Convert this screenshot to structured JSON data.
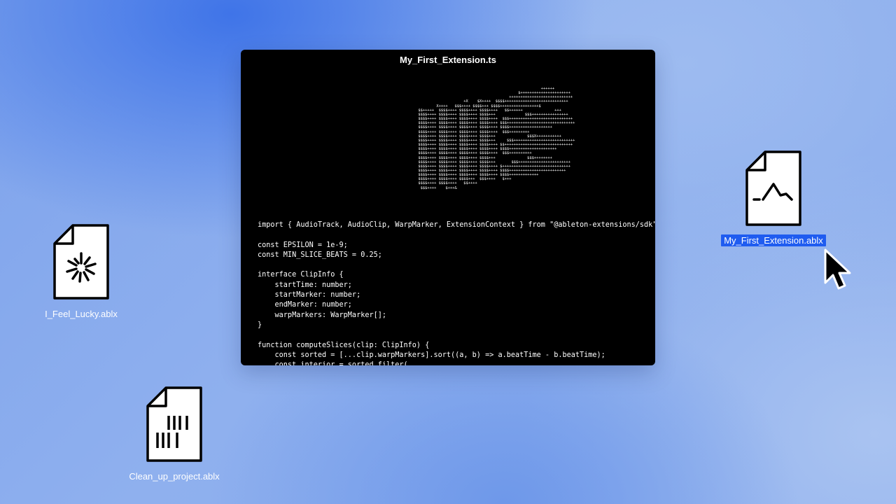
{
  "window": {
    "title": "My_First_Extension.ts",
    "ascii_art": "                                                                            ++++++\n                                                                  $++++++++++++++++++++++\n                                                              ++++++++++++++++++++++++++++\n                                          +X    $X++++  $$$$++++++++++++++++++++++++++++\n                              X++++   $$$++++ $$$$+++ $$$$+++++++++++++++++$\n                      $$+++++  $$$$++++ $$$$++++ $$$$++++   $$++++++              +++\n                      $$$$++++ $$$$++++ $$$$++++ $$$$+++             $$$++++++++++++++++\n                      $$$$++++ $$$$++++ $$$$++++ $$$$++++  $$$++++++++++++++++++++++++++++\n                      $$$$++++ $$$$++++ $$$$++++ $$$$++++ $$$++++++++++++++++++++++++++++++\n                      $$$$++++ $$$$++++ $$$$++++ $$$$++++ $$$$+++++++++++++++++++\n                      $$$$++++ $$$$++++ $$$$++++ $$$$++++  $$$+++++++++\n                      $$$$++++ $$$$++++ $$$$++++ $$$$+++              $$$X+++++++++++\n                      $$$$++++ $$$$++++ $$$$++++ $$$$+++     $$$+++++++++++++++++++++++++++\n                      $$$$++++ $$$$++++ $$$$++++ $$$$++++ $$++++++++++++++++++++++++++++++\n                      $$$$++++ $$$$++++ $$$$++++ $$$$++++ $$$$+++++++++++++++++++++\n                      $$$$++++ $$$$++++ $$$$++++ $$$$++++  $$$++++++++++\n                      $$$$++++ $$$$++++ $$$$++++ $$$$+++              $$$++++++++\n                      $$$$++++ $$$$++++ $$$$++++ $$$$+++       $$$+++++++++++++++++++++++\n                      $$$$++++ $$$$++++ $$$$++++ $$$$++++ $++++++++++++++++++++++++++++++\n                      $$$$++++ $$$$++++ $$$$++++ $$$$++++ $$$$+++++++++++++++++++++++++\n                      $$$$++++ $$$$++++ $$$$++++ $$$$++++ $$$$+++++++++++++\n                      $$$$++++ $$$$++++ $$$$+++  $$$++++   $+++\n                      $$$$++++ $$$$++++   $$++++\n                       $$$++++    $+++&",
    "code": "import { AudioTrack, AudioClip, WarpMarker, ExtensionContext } from \"@ableton-extensions/sdk\";\n\nconst EPSILON = 1e-9;\nconst MIN_SLICE_BEATS = 0.25;\n\ninterface ClipInfo {\n    startTime: number;\n    startMarker: number;\n    endMarker: number;\n    warpMarkers: WarpMarker[];\n}\n\nfunction computeSlices(clip: ClipInfo) {\n    const sorted = [...clip.warpMarkers].sort((a, b) => a.beatTime - b.beatTime);\n    const interior = sorted.filter("
  },
  "desktop": {
    "files": [
      {
        "name": "I_Feel_Lucky.ablx",
        "icon": "sparkle-file-icon",
        "selected": false
      },
      {
        "name": "Clean_up_project.ablx",
        "icon": "barcode-file-icon",
        "selected": false
      },
      {
        "name": "My_First_Extension.ablx",
        "icon": "waveform-file-icon",
        "selected": true
      }
    ]
  },
  "colors": {
    "selection": "#1f5cf0",
    "window_bg": "#000000",
    "desktop_accent": "#3f74e8"
  }
}
